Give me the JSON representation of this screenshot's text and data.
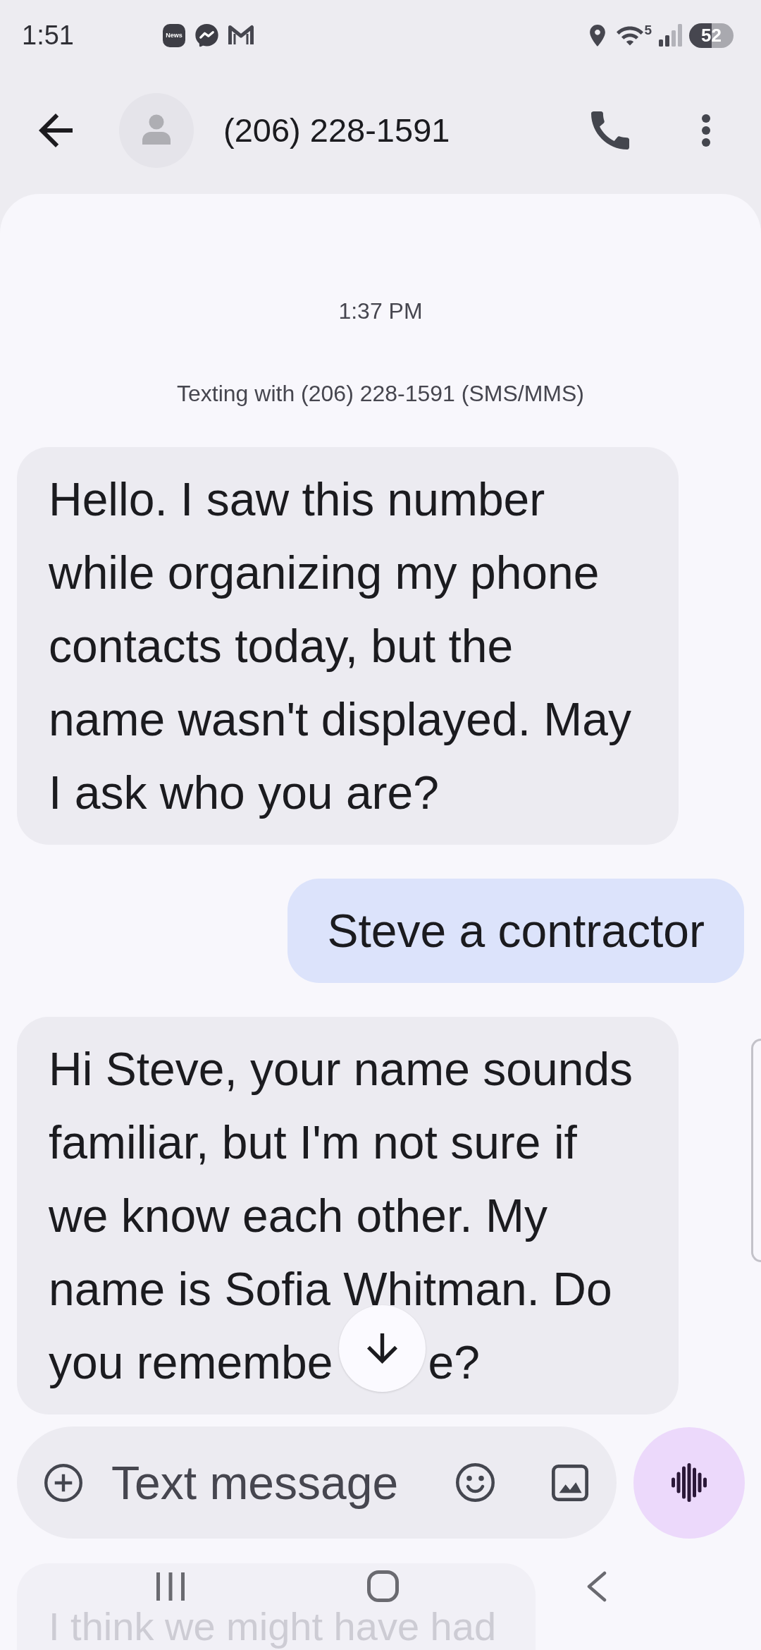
{
  "status_bar": {
    "time": "1:51",
    "notification_icons": [
      {
        "kind": "news",
        "label": "News"
      },
      {
        "kind": "chat"
      },
      {
        "kind": "mail"
      }
    ],
    "wifi_band": "5",
    "battery": "52"
  },
  "header": {
    "title": "(206) 228-1591"
  },
  "conversation": {
    "timestamp": "1:37 PM",
    "info": "Texting with (206) 228-1591 (SMS/MMS)",
    "messages": [
      {
        "kind": "received",
        "text": "Hello. I saw this number while organizing my phone contacts today, but the name wasn't displayed. May I ask who you are?",
        "faded": false
      },
      {
        "kind": "sent",
        "text": "Steve a contractor",
        "faded": false
      },
      {
        "kind": "received",
        "text": "Hi Steve, your name sounds familiar, but I'm not sure if we know each other. My name is Sofia Whitman. Do",
        "covered_line": {
          "before": "you remembe",
          "after": "e?"
        },
        "faded": false
      },
      {
        "kind": "received",
        "text": "I think we might have had",
        "faded": true
      }
    ]
  },
  "composer": {
    "placeholder": "Text message"
  }
}
